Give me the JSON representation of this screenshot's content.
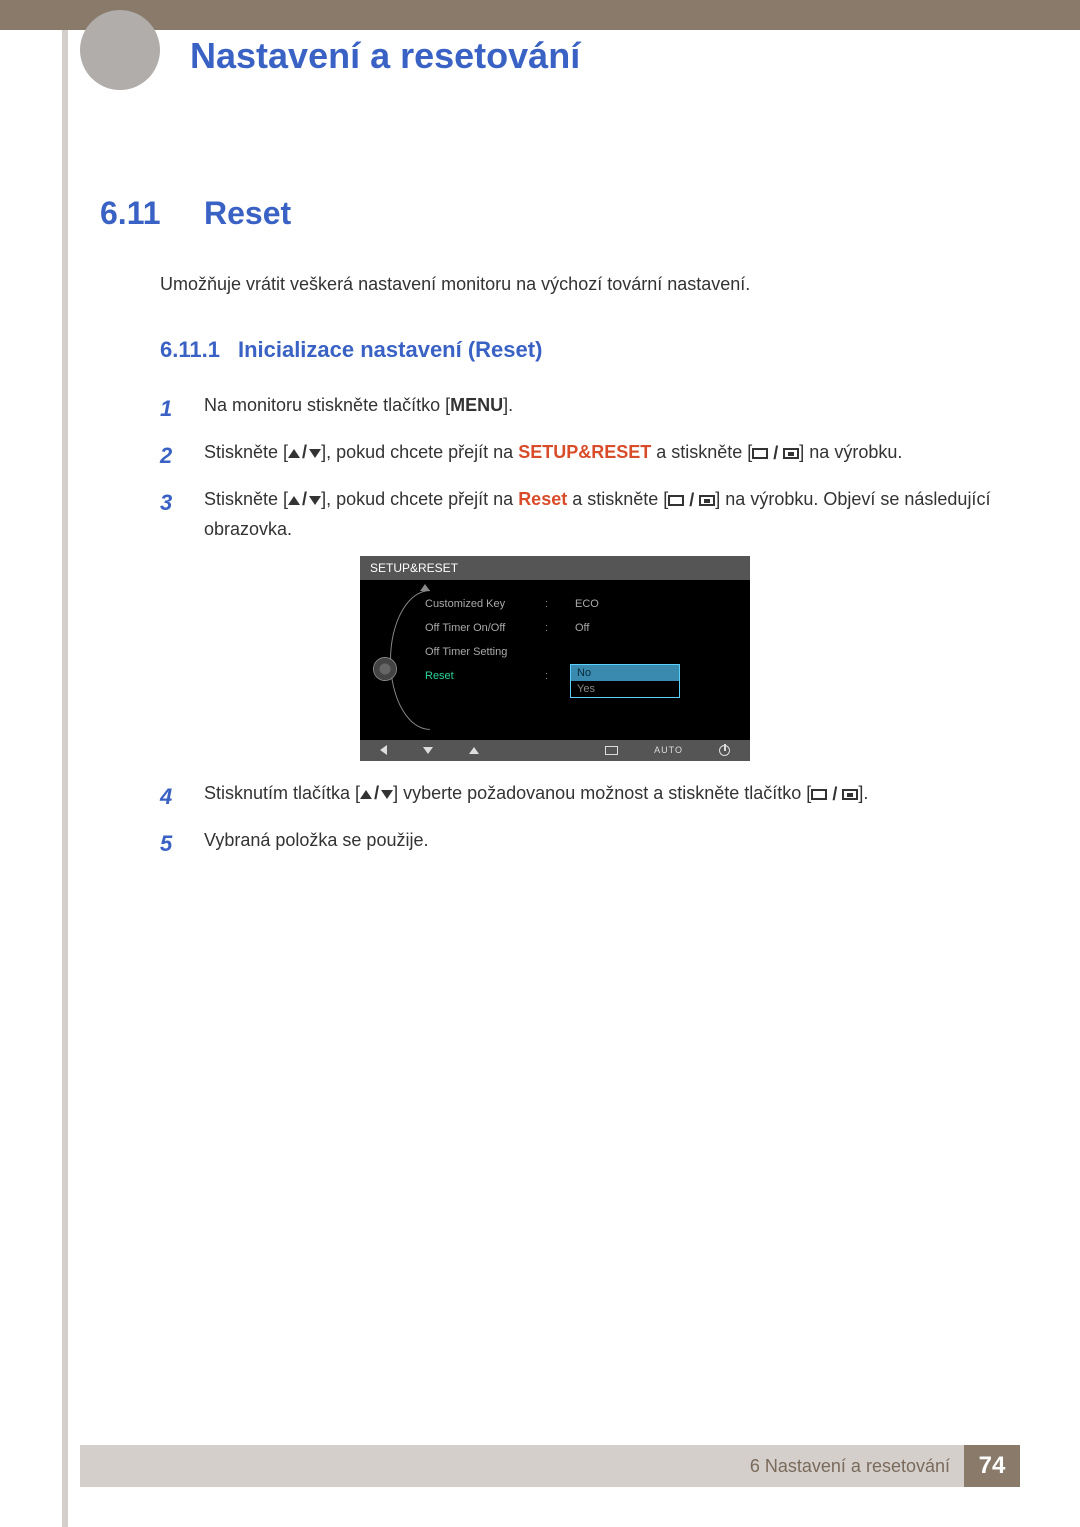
{
  "chapter_title": "Nastavení a resetování",
  "section": {
    "number": "6.11",
    "title": "Reset"
  },
  "section_desc": "Umožňuje vrátit veškerá nastavení monitoru na výchozí tovární nastavení.",
  "subsection": {
    "number": "6.11.1",
    "title": "Inicializace nastavení (Reset)"
  },
  "steps": {
    "s1": {
      "num": "1",
      "pre": "Na monitoru stiskněte tlačítko [",
      "menu": "MENU",
      "post": "]."
    },
    "s2": {
      "num": "2",
      "pre": "Stiskněte [",
      "mid": "], pokud chcete přejít na ",
      "target": "SETUP&RESET",
      "mid2": " a stiskněte [",
      "post": "] na výrobku."
    },
    "s3": {
      "num": "3",
      "pre": "Stiskněte [",
      "mid": "], pokud chcete přejít na ",
      "target": "Reset",
      "mid2": " a stiskněte [",
      "post": "] na výrobku. Objeví se následující obrazovka."
    },
    "s4": {
      "num": "4",
      "pre": "Stisknutím tlačítka [",
      "mid": "] vyberte požadovanou možnost a stiskněte tlačítko [",
      "post": "]."
    },
    "s5": {
      "num": "5",
      "text": "Vybraná položka se použije."
    }
  },
  "osd": {
    "header": "SETUP&RESET",
    "rows": [
      {
        "label": "Customized Key",
        "sep": ":",
        "value": "ECO"
      },
      {
        "label": "Off Timer On/Off",
        "sep": ":",
        "value": "Off"
      },
      {
        "label": "Off Timer Setting",
        "sep": "",
        "value": ""
      },
      {
        "label": "Reset",
        "sep": ":",
        "value": ""
      }
    ],
    "select": {
      "no": "No",
      "yes": "Yes"
    },
    "footer_auto": "AUTO"
  },
  "footer": {
    "chapter_label": "6 Nastavení a resetování",
    "page": "74"
  }
}
